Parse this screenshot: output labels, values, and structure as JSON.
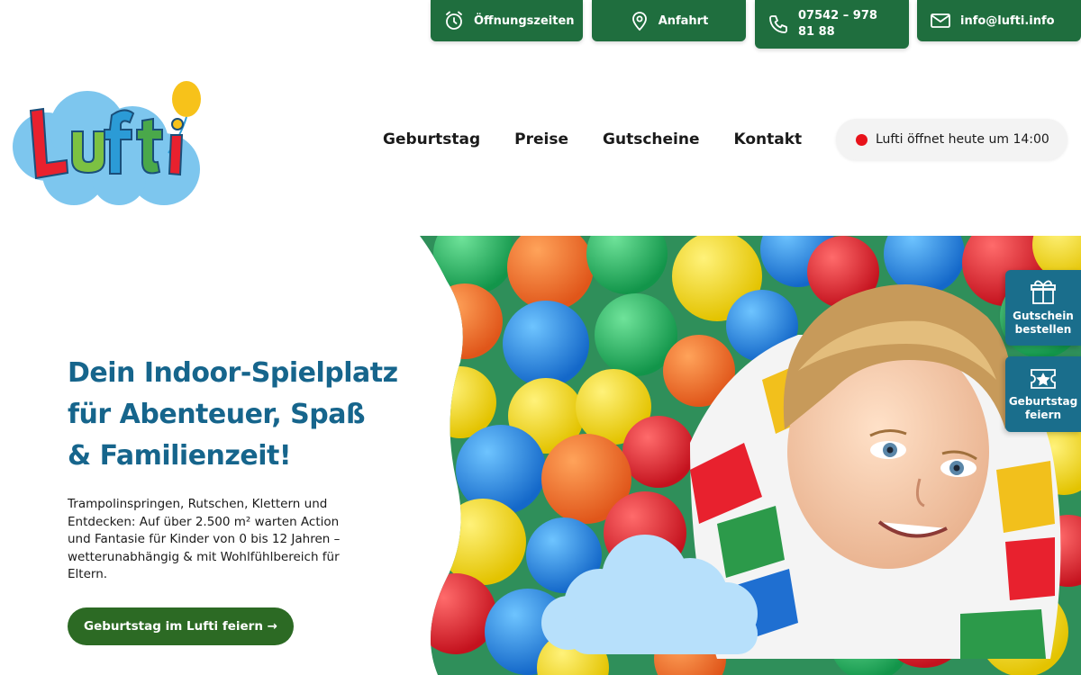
{
  "topbar": {
    "hours_label": "Öffnungszeiten",
    "route_label": "Anfahrt",
    "phone_label": "07542 – 978 81 88",
    "mail_label": "info@lufti.info"
  },
  "logo": {
    "text": "Lufti"
  },
  "nav": {
    "items": [
      {
        "label": "Geburtstag"
      },
      {
        "label": "Preise"
      },
      {
        "label": "Gutscheine"
      },
      {
        "label": "Kontakt"
      }
    ]
  },
  "status": {
    "text": "Lufti öffnet heute um 14:00",
    "dot_color": "#e8121a"
  },
  "hero": {
    "headline_lines": [
      "Dein Indoor-Spielplatz",
      "für Abenteuer, Spaß",
      "& Familienzeit!"
    ],
    "lead": "Trampolinspringen, Rutschen, Klettern und Entdecken: Auf über 2.500 m² warten Action und Fantasie für Kinder von 0 bis 12 Jahren – wetterunabhängig & mit Wohlfühlbereich für Eltern.",
    "cta_label": "Geburtstag im Lufti feiern →"
  },
  "side_tabs": {
    "voucher_label": "Gutschein bestellen",
    "birthday_label": "Geburtstag feiern"
  },
  "colors": {
    "top_green": "#1f6e3e",
    "headline_blue": "#16658c",
    "cta_green": "#2c6a24",
    "side_tab_blue": "#1a6e8c"
  }
}
